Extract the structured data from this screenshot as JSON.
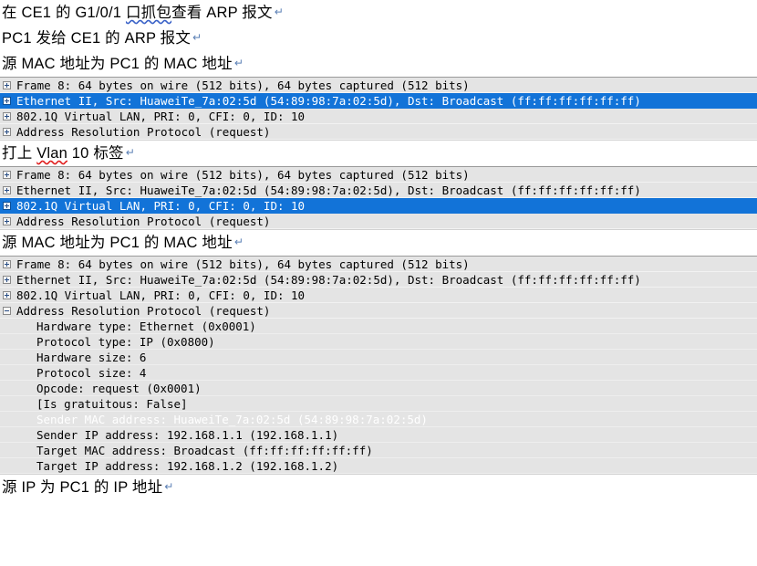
{
  "document": {
    "paragraphs": [
      {
        "id": "p1",
        "segments": [
          {
            "text": "在 CE1 的 G1/0/1 ",
            "mark": "none"
          },
          {
            "text": "口抓包",
            "mark": "blue"
          },
          {
            "text": "查看 ARP 报文",
            "mark": "none"
          }
        ],
        "pilcrow": "↵"
      },
      {
        "id": "p2",
        "segments": [
          {
            "text": "PC1 发给 CE1 的 ARP 报文",
            "mark": "none"
          }
        ],
        "pilcrow": "↵"
      },
      {
        "id": "p3",
        "segments": [
          {
            "text": "源 MAC 地址为 PC1 的 MAC 地址",
            "mark": "none"
          }
        ],
        "pilcrow": "↵"
      },
      {
        "id": "p4",
        "segments": [
          {
            "text": "打上 ",
            "mark": "none"
          },
          {
            "text": "Vlan",
            "mark": "red"
          },
          {
            "text": " 10 标签",
            "mark": "none"
          }
        ],
        "pilcrow": "↵"
      },
      {
        "id": "p5",
        "segments": [
          {
            "text": "源 MAC 地址为 PC1 的 MAC 地址",
            "mark": "none"
          }
        ],
        "pilcrow": "↵"
      },
      {
        "id": "p6",
        "segments": [
          {
            "text": "源 IP 为 PC1 的 IP 地址",
            "mark": "none"
          }
        ],
        "pilcrow": "↵"
      }
    ]
  },
  "icons": {
    "expand": "plus-box-icon",
    "collapse": "minus-box-icon"
  },
  "colors": {
    "selection_blue": "#1273d8",
    "pane_background": "#e4e4e4",
    "text": "#000000",
    "spellcheck_red": "#e02020",
    "grammarcheck_blue": "#3b63c8"
  },
  "packet_panes": [
    {
      "id": "pane1",
      "rows": [
        {
          "expander": "plus",
          "level": 0,
          "selected": false,
          "text": "Frame 8: 64 bytes on wire (512 bits), 64 bytes captured (512 bits)"
        },
        {
          "expander": "plus",
          "level": 0,
          "selected": true,
          "text": "Ethernet II, Src: HuaweiTe_7a:02:5d (54:89:98:7a:02:5d), Dst: Broadcast (ff:ff:ff:ff:ff:ff)"
        },
        {
          "expander": "plus",
          "level": 0,
          "selected": false,
          "text": "802.1Q Virtual LAN, PRI: 0, CFI: 0, ID: 10"
        },
        {
          "expander": "plus",
          "level": 0,
          "selected": false,
          "text": "Address Resolution Protocol (request)"
        }
      ]
    },
    {
      "id": "pane2",
      "rows": [
        {
          "expander": "plus",
          "level": 0,
          "selected": false,
          "text": "Frame 8: 64 bytes on wire (512 bits), 64 bytes captured (512 bits)"
        },
        {
          "expander": "plus",
          "level": 0,
          "selected": false,
          "text": "Ethernet II, Src: HuaweiTe_7a:02:5d (54:89:98:7a:02:5d), Dst: Broadcast (ff:ff:ff:ff:ff:ff)"
        },
        {
          "expander": "plus",
          "level": 0,
          "selected": true,
          "text": "802.1Q Virtual LAN, PRI: 0, CFI: 0, ID: 10"
        },
        {
          "expander": "plus",
          "level": 0,
          "selected": false,
          "text": "Address Resolution Protocol (request)"
        }
      ]
    },
    {
      "id": "pane3",
      "rows": [
        {
          "expander": "plus",
          "level": 0,
          "selected": false,
          "text": "Frame 8: 64 bytes on wire (512 bits), 64 bytes captured (512 bits)"
        },
        {
          "expander": "plus",
          "level": 0,
          "selected": false,
          "text": "Ethernet II, Src: HuaweiTe_7a:02:5d (54:89:98:7a:02:5d), Dst: Broadcast (ff:ff:ff:ff:ff:ff)"
        },
        {
          "expander": "plus",
          "level": 0,
          "selected": false,
          "text": "802.1Q Virtual LAN, PRI: 0, CFI: 0, ID: 10"
        },
        {
          "expander": "minus",
          "level": 0,
          "selected": false,
          "text": "Address Resolution Protocol (request)"
        },
        {
          "expander": "none",
          "level": 1,
          "selected": false,
          "text": "Hardware type: Ethernet (0x0001)"
        },
        {
          "expander": "none",
          "level": 1,
          "selected": false,
          "text": "Protocol type: IP (0x0800)"
        },
        {
          "expander": "none",
          "level": 1,
          "selected": false,
          "text": "Hardware size: 6"
        },
        {
          "expander": "none",
          "level": 1,
          "selected": false,
          "text": "Protocol size: 4"
        },
        {
          "expander": "none",
          "level": 1,
          "selected": false,
          "text": "Opcode: request (0x0001)"
        },
        {
          "expander": "none",
          "level": 1,
          "selected": false,
          "text": "[Is gratuitous: False]"
        },
        {
          "expander": "none",
          "level": 1,
          "selected": true,
          "text": "Sender MAC address: HuaweiTe_7a:02:5d (54:89:98:7a:02:5d)"
        },
        {
          "expander": "none",
          "level": 1,
          "selected": false,
          "text": "Sender IP address: 192.168.1.1 (192.168.1.1)"
        },
        {
          "expander": "none",
          "level": 1,
          "selected": false,
          "text": "Target MAC address: Broadcast (ff:ff:ff:ff:ff:ff)"
        },
        {
          "expander": "none",
          "level": 1,
          "selected": false,
          "text": "Target IP address: 192.168.1.2 (192.168.1.2)"
        }
      ]
    }
  ],
  "layout_order": [
    "p1",
    "p2",
    "p3",
    "pane1",
    "p4",
    "pane2",
    "p5",
    "pane3",
    "p6"
  ]
}
